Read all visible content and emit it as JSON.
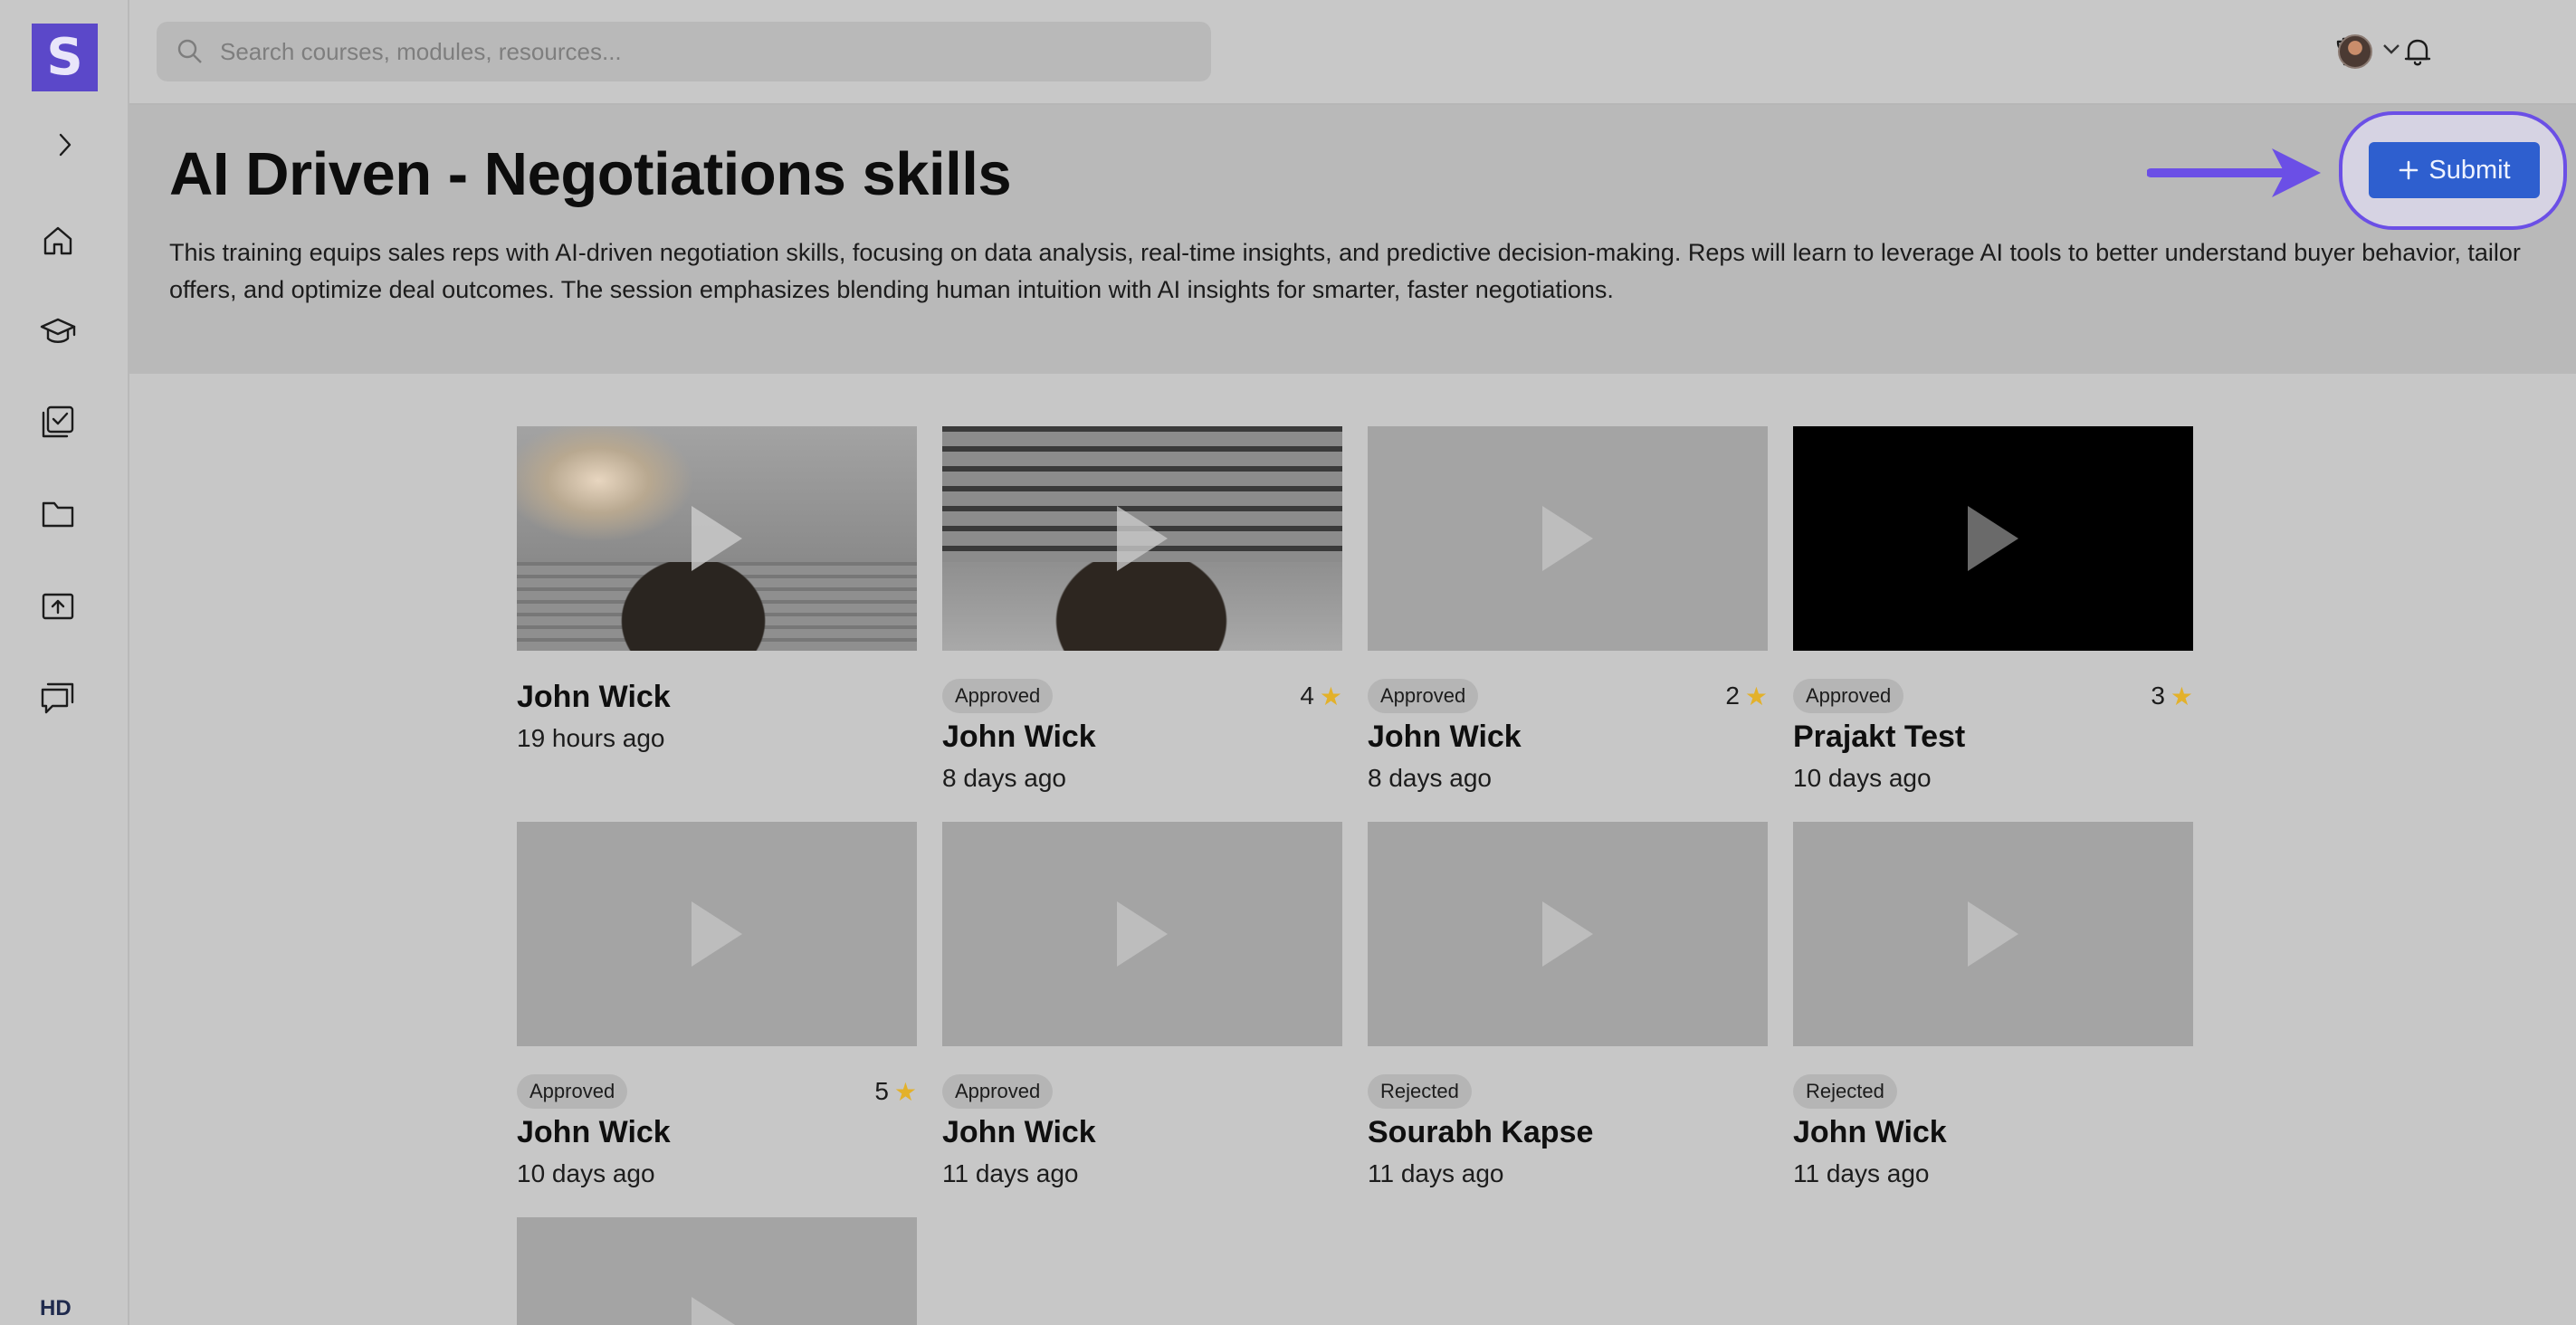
{
  "sidebar": {
    "logo_letter": "S",
    "items": [
      {
        "name": "home-icon"
      },
      {
        "name": "graduation-cap-icon"
      },
      {
        "name": "checklist-icon"
      },
      {
        "name": "folder-icon"
      },
      {
        "name": "upload-icon"
      },
      {
        "name": "chat-icon"
      }
    ],
    "bottom_badge": "HD"
  },
  "search": {
    "placeholder": "Search courses, modules, resources..."
  },
  "header": {
    "title": "AI Driven - Negotiations skills",
    "description": "This training equips sales reps with AI-driven negotiation skills, focusing on data analysis, real-time insights, and predictive decision-making. Reps will learn to leverage AI tools to better understand buyer behavior, tailor offers, and optimize deal outcomes. The session emphasizes blending human intuition with AI insights for smarter, faster negotiations.",
    "submit_label": "Submit",
    "highlight_color": "#6b4fe6",
    "submit_color": "#2e5fcf"
  },
  "submissions": [
    {
      "name": "John Wick",
      "time": "19 hours ago",
      "status": "",
      "rating": ""
    },
    {
      "name": "John Wick",
      "time": "8 days ago",
      "status": "Approved",
      "rating": "4"
    },
    {
      "name": "John Wick",
      "time": "8 days ago",
      "status": "Approved",
      "rating": "2"
    },
    {
      "name": "Prajakt Test",
      "time": "10 days ago",
      "status": "Approved",
      "rating": "3"
    },
    {
      "name": "John Wick",
      "time": "10 days ago",
      "status": "Approved",
      "rating": "5"
    },
    {
      "name": "John Wick",
      "time": "11 days ago",
      "status": "Approved",
      "rating": ""
    },
    {
      "name": "Sourabh Kapse",
      "time": "11 days ago",
      "status": "Rejected",
      "rating": ""
    },
    {
      "name": "John Wick",
      "time": "11 days ago",
      "status": "Rejected",
      "rating": ""
    }
  ]
}
